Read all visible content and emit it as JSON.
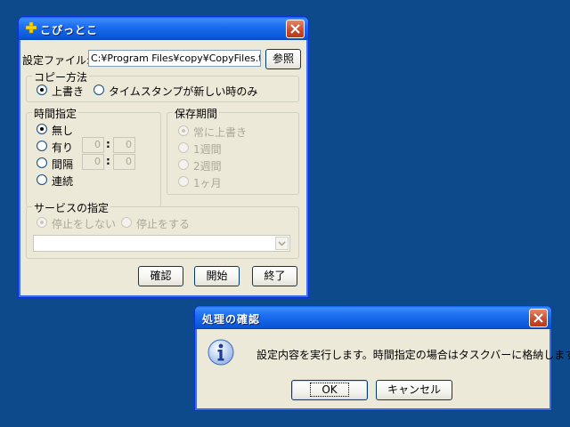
{
  "main_window": {
    "title": "こぴっとこ",
    "settings_file_label": "設定ファイル:",
    "settings_file_value": "C:¥Program Files¥copy¥CopyFiles.txt",
    "browse_label": "参照",
    "copy_method": {
      "title": "コピー方法",
      "overwrite_label": "上書き",
      "newer_only_label": "タイムスタンプが新しい時のみ"
    },
    "time_spec": {
      "title": "時間指定",
      "none_label": "無し",
      "yes_label": "有り",
      "interval_label": "間隔",
      "continuous_label": "連続",
      "yes_hour": "0",
      "yes_min": "0",
      "interval_hour": "0",
      "interval_min": "0",
      "colon": ":"
    },
    "retention": {
      "title": "保存期間",
      "always_overwrite_label": "常に上書き",
      "one_week_label": "1週間",
      "two_weeks_label": "2週間",
      "one_month_label": "1ヶ月"
    },
    "service": {
      "title": "サービスの指定",
      "no_stop_label": "停止をしない",
      "stop_label": "停止をする",
      "combo_value": ""
    },
    "confirm_label": "確認",
    "start_label": "開始",
    "exit_label": "終了"
  },
  "dialog": {
    "title": "処理の確認",
    "message": "設定内容を実行します。時間指定の場合はタスクバーに格納します。",
    "ok_label": "OK",
    "cancel_label": "キャンセル"
  },
  "colors": {
    "desktop": "#0c4a8c",
    "window_face": "#ece9d8",
    "title_blue": "#0a58d8",
    "close_red": "#c94a2a"
  },
  "icons": {
    "app": "yellow-plus-icon",
    "close": "close-x-icon",
    "info": "information-icon",
    "combo": "chevron-down-icon"
  }
}
